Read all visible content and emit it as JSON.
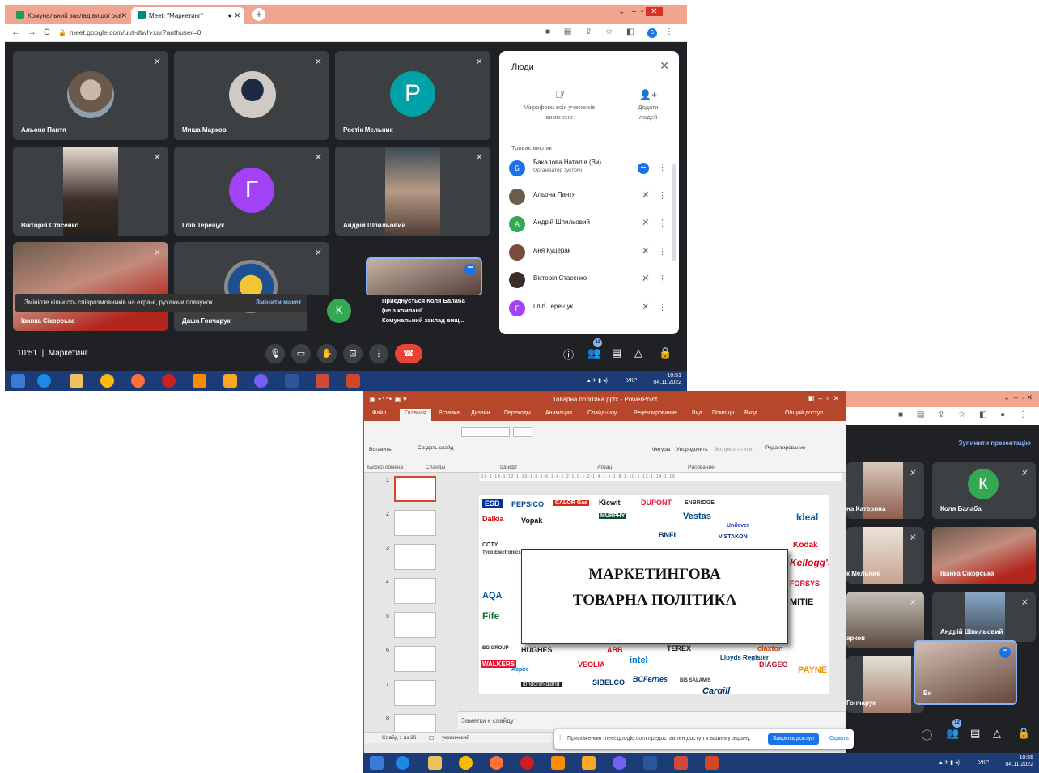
{
  "meet1": {
    "tabs": [
      "Комунальний заклад вищої осв",
      "Meet: \"Маркетинг\""
    ],
    "url": "meet.google.com/uut-dtwh-xar?authuser=0",
    "profile_initial": "Б",
    "tiles": [
      {
        "name": "Альона Пантя"
      },
      {
        "name": "Миша Марков"
      },
      {
        "name": "Ростік Мельник",
        "initial": "Р"
      },
      {
        "name": "Вікторія Стасенко"
      },
      {
        "name": "Гліб Терещук",
        "initial": "Г"
      },
      {
        "name": "Андрій Шпильовий"
      },
      {
        "name": "Іванка Сікорська"
      },
      {
        "name": "Даша Гончарук"
      }
    ],
    "toast_text": "Змініоте кількість співрозмовників на екрані, рухаючи повзунок",
    "toast_action": "Змінити макет",
    "join_initial": "К",
    "join_text_1": "Приєднується Коля Балаба",
    "join_text_2": "(не з компанії",
    "join_text_3": "Комунальний заклад вищ...",
    "people": {
      "title": "Люди",
      "action_mute": "Мікрофони всіх учасників вимкнено",
      "action_add": "Додати людей",
      "section": "Триває виклик",
      "list": [
        {
          "name": "Бакалова Наталія (Ви)",
          "sub": "Організатор зустрічі",
          "initial": "Б",
          "color": "#1a73e8"
        },
        {
          "name": "Альона Пантя",
          "initial": "",
          "color": "#6d5c4e"
        },
        {
          "name": "Андрій Шпильовий",
          "initial": "А",
          "color": "#34a853"
        },
        {
          "name": "Аня Куцерак",
          "initial": "",
          "color": "#7a4b3a"
        },
        {
          "name": "Вікторія Стасенко",
          "initial": "",
          "color": "#3a2e28"
        },
        {
          "name": "Гліб Терещук",
          "initial": "Г",
          "color": "#a142f4"
        }
      ]
    },
    "time": "10:51",
    "meeting": "Маркетинг",
    "participants_badge": "11",
    "tray_lang": "УКР",
    "clock_time": "10:51",
    "clock_date": "04.11.2022"
  },
  "ppt": {
    "title": "Товарна політика.pptx - PowerPoint",
    "tabs": [
      "Файл",
      "Главная",
      "Вставка",
      "Дизайн",
      "Переходы",
      "Анимация",
      "Слайд-шоу",
      "Рецензирование",
      "Вид",
      "Помощн",
      "Вход",
      "Общий доступ"
    ],
    "ribbon_groups": [
      "Буфер обмена",
      "Слайды",
      "Шрифт",
      "Абзац",
      "Рисование"
    ],
    "ribbon_buttons": [
      "Вставить",
      "Создать слайд",
      "Фигуры",
      "Упорядочить",
      "Экспресс-стили",
      "Редактирование"
    ],
    "slide_title_1": "МАРКЕТИНГОВА",
    "slide_title_2": "ТОВАРНА ПОЛІТИКА",
    "logos": [
      "PEPSICO",
      "CALOR Gas",
      "Kiewit",
      "DUPONT",
      "ENBRIDGE",
      "Dalkia",
      "Vopak",
      "MURPHY",
      "Vestas",
      "Unilever",
      "Ideal",
      "COTY",
      "BNFL",
      "VISTAKON",
      "Kodak",
      "Tyco Electronics",
      "Kellogg's",
      "FORSYS",
      "AQA",
      "MITIE",
      "Fife",
      "BG GROUP",
      "HUGHES",
      "ABB",
      "TEREX",
      "claxton",
      "WALKERS",
      "Aspire",
      "VEOLIA",
      "intel",
      "Lloyds Register",
      "DIAGEO",
      "PAYNE",
      "SIBELCO",
      "BCFerries",
      "BIS SALAMIS",
      "Cargill",
      "londonmidland"
    ],
    "notes_placeholder": "Заметки к слайду",
    "status_slide": "Слайд 1 из 26",
    "status_lang": "украинский"
  },
  "meet2": {
    "present_button": "Зупинити презентацію",
    "tiles": [
      "на Катерина",
      "Коля Балаба",
      "к Мельник",
      "Іванка Сікорська",
      "арков",
      "Андрій Шпильовий",
      "Гончарук",
      "Ви"
    ],
    "share_text": "Приложению meet.google.com предоставлен доступ к вашему экрану.",
    "share_stop": "Закрыть доступ",
    "share_hide": "Скрыть",
    "participants_badge": "12",
    "tray_lang": "УКР",
    "clock_time": "10:55",
    "clock_date": "04.11.2022"
  }
}
